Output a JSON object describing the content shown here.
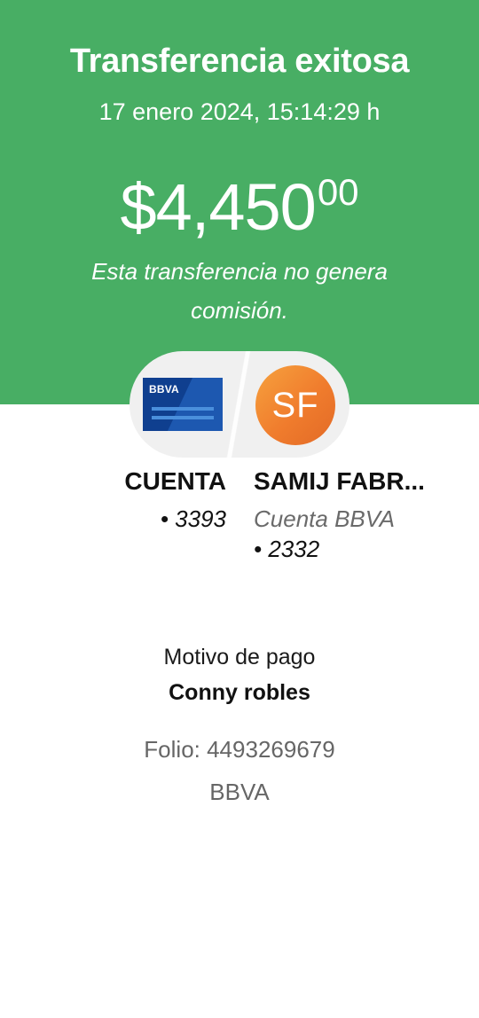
{
  "header": {
    "title": "Transferencia exitosa",
    "datetime": "17 enero 2024, 15:14:29 h",
    "amount_main": "$4,450",
    "amount_cents": "00",
    "fee_note": "Esta transferencia no genera comisión."
  },
  "transfer": {
    "from": {
      "card_brand": "BBVA",
      "name": "CUENTA",
      "account": "• 3393"
    },
    "to": {
      "initials": "SF",
      "name": "SAMIJ FABR...",
      "bank": "Cuenta BBVA",
      "account": "• 2332"
    }
  },
  "details": {
    "motivo_label": "Motivo de pago",
    "motivo_value": "Conny robles",
    "folio": "Folio: 4493269679",
    "bank": "BBVA"
  },
  "colors": {
    "header_green": "#48ae64",
    "card_blue": "#0f3f8f",
    "avatar_orange": "#f07c2d"
  },
  "icons": {
    "from_icon": "bbva-card-icon",
    "to_icon": "initials-avatar"
  }
}
